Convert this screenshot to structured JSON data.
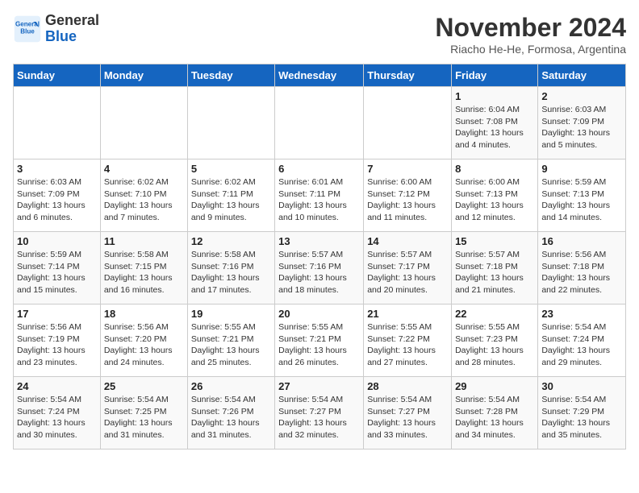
{
  "header": {
    "logo_line1": "General",
    "logo_line2": "Blue",
    "month": "November 2024",
    "location": "Riacho He-He, Formosa, Argentina"
  },
  "days_of_week": [
    "Sunday",
    "Monday",
    "Tuesday",
    "Wednesday",
    "Thursday",
    "Friday",
    "Saturday"
  ],
  "weeks": [
    [
      {
        "day": "",
        "info": ""
      },
      {
        "day": "",
        "info": ""
      },
      {
        "day": "",
        "info": ""
      },
      {
        "day": "",
        "info": ""
      },
      {
        "day": "",
        "info": ""
      },
      {
        "day": "1",
        "info": "Sunrise: 6:04 AM\nSunset: 7:08 PM\nDaylight: 13 hours and 4 minutes."
      },
      {
        "day": "2",
        "info": "Sunrise: 6:03 AM\nSunset: 7:09 PM\nDaylight: 13 hours and 5 minutes."
      }
    ],
    [
      {
        "day": "3",
        "info": "Sunrise: 6:03 AM\nSunset: 7:09 PM\nDaylight: 13 hours and 6 minutes."
      },
      {
        "day": "4",
        "info": "Sunrise: 6:02 AM\nSunset: 7:10 PM\nDaylight: 13 hours and 7 minutes."
      },
      {
        "day": "5",
        "info": "Sunrise: 6:02 AM\nSunset: 7:11 PM\nDaylight: 13 hours and 9 minutes."
      },
      {
        "day": "6",
        "info": "Sunrise: 6:01 AM\nSunset: 7:11 PM\nDaylight: 13 hours and 10 minutes."
      },
      {
        "day": "7",
        "info": "Sunrise: 6:00 AM\nSunset: 7:12 PM\nDaylight: 13 hours and 11 minutes."
      },
      {
        "day": "8",
        "info": "Sunrise: 6:00 AM\nSunset: 7:13 PM\nDaylight: 13 hours and 12 minutes."
      },
      {
        "day": "9",
        "info": "Sunrise: 5:59 AM\nSunset: 7:13 PM\nDaylight: 13 hours and 14 minutes."
      }
    ],
    [
      {
        "day": "10",
        "info": "Sunrise: 5:59 AM\nSunset: 7:14 PM\nDaylight: 13 hours and 15 minutes."
      },
      {
        "day": "11",
        "info": "Sunrise: 5:58 AM\nSunset: 7:15 PM\nDaylight: 13 hours and 16 minutes."
      },
      {
        "day": "12",
        "info": "Sunrise: 5:58 AM\nSunset: 7:16 PM\nDaylight: 13 hours and 17 minutes."
      },
      {
        "day": "13",
        "info": "Sunrise: 5:57 AM\nSunset: 7:16 PM\nDaylight: 13 hours and 18 minutes."
      },
      {
        "day": "14",
        "info": "Sunrise: 5:57 AM\nSunset: 7:17 PM\nDaylight: 13 hours and 20 minutes."
      },
      {
        "day": "15",
        "info": "Sunrise: 5:57 AM\nSunset: 7:18 PM\nDaylight: 13 hours and 21 minutes."
      },
      {
        "day": "16",
        "info": "Sunrise: 5:56 AM\nSunset: 7:18 PM\nDaylight: 13 hours and 22 minutes."
      }
    ],
    [
      {
        "day": "17",
        "info": "Sunrise: 5:56 AM\nSunset: 7:19 PM\nDaylight: 13 hours and 23 minutes."
      },
      {
        "day": "18",
        "info": "Sunrise: 5:56 AM\nSunset: 7:20 PM\nDaylight: 13 hours and 24 minutes."
      },
      {
        "day": "19",
        "info": "Sunrise: 5:55 AM\nSunset: 7:21 PM\nDaylight: 13 hours and 25 minutes."
      },
      {
        "day": "20",
        "info": "Sunrise: 5:55 AM\nSunset: 7:21 PM\nDaylight: 13 hours and 26 minutes."
      },
      {
        "day": "21",
        "info": "Sunrise: 5:55 AM\nSunset: 7:22 PM\nDaylight: 13 hours and 27 minutes."
      },
      {
        "day": "22",
        "info": "Sunrise: 5:55 AM\nSunset: 7:23 PM\nDaylight: 13 hours and 28 minutes."
      },
      {
        "day": "23",
        "info": "Sunrise: 5:54 AM\nSunset: 7:24 PM\nDaylight: 13 hours and 29 minutes."
      }
    ],
    [
      {
        "day": "24",
        "info": "Sunrise: 5:54 AM\nSunset: 7:24 PM\nDaylight: 13 hours and 30 minutes."
      },
      {
        "day": "25",
        "info": "Sunrise: 5:54 AM\nSunset: 7:25 PM\nDaylight: 13 hours and 31 minutes."
      },
      {
        "day": "26",
        "info": "Sunrise: 5:54 AM\nSunset: 7:26 PM\nDaylight: 13 hours and 31 minutes."
      },
      {
        "day": "27",
        "info": "Sunrise: 5:54 AM\nSunset: 7:27 PM\nDaylight: 13 hours and 32 minutes."
      },
      {
        "day": "28",
        "info": "Sunrise: 5:54 AM\nSunset: 7:27 PM\nDaylight: 13 hours and 33 minutes."
      },
      {
        "day": "29",
        "info": "Sunrise: 5:54 AM\nSunset: 7:28 PM\nDaylight: 13 hours and 34 minutes."
      },
      {
        "day": "30",
        "info": "Sunrise: 5:54 AM\nSunset: 7:29 PM\nDaylight: 13 hours and 35 minutes."
      }
    ]
  ]
}
